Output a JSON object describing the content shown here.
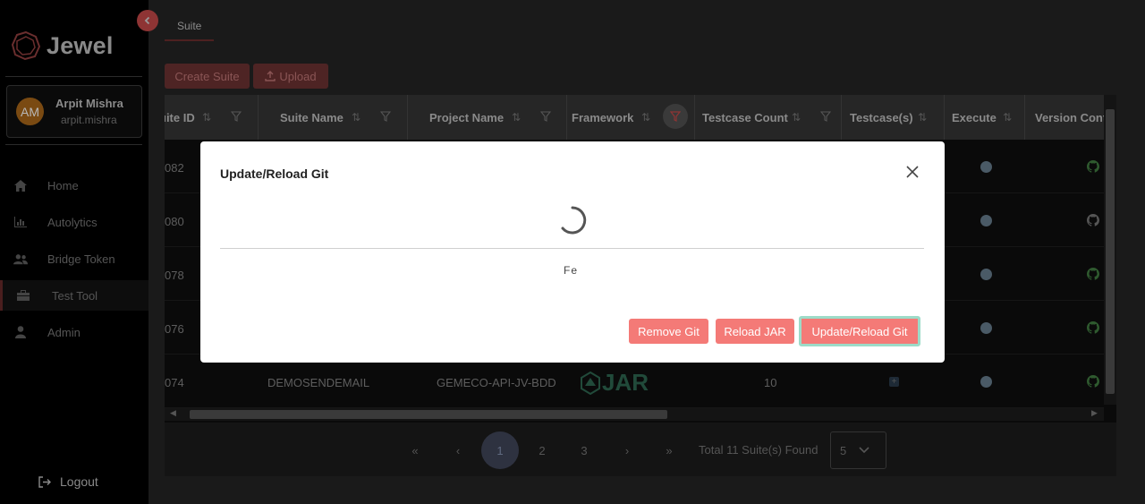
{
  "app": {
    "name": "Jewel"
  },
  "user": {
    "initials": "AM",
    "name": "Arpit Mishra",
    "handle": "arpit.mishra"
  },
  "nav": [
    {
      "label": "Home",
      "icon": "home-icon"
    },
    {
      "label": "Autolytics",
      "icon": "bar-chart-icon"
    },
    {
      "label": "Bridge Token",
      "icon": "users-icon"
    },
    {
      "label": "Test Tool",
      "icon": "toolbox-icon",
      "active": true
    },
    {
      "label": "Admin",
      "icon": "user-icon"
    }
  ],
  "logout_label": "Logout",
  "tabs": [
    {
      "label": "Suite"
    }
  ],
  "toolbar": {
    "create_label": "Create Suite",
    "upload_label": "Upload"
  },
  "table": {
    "columns": [
      "uite ID",
      "Suite Name",
      "Project Name",
      "Framework",
      "Testcase Count",
      "Testcase(s)",
      "Execute",
      "Version Cont"
    ],
    "rows": [
      {
        "id": "082",
        "suite_name": "",
        "project_name": "",
        "framework": "",
        "testcase_count": ""
      },
      {
        "id": "080",
        "suite_name": "",
        "project_name": "",
        "framework": "",
        "testcase_count": ""
      },
      {
        "id": "078",
        "suite_name": "",
        "project_name": "",
        "framework": "",
        "testcase_count": ""
      },
      {
        "id": "076",
        "suite_name": "",
        "project_name": "",
        "framework": "",
        "testcase_count": ""
      },
      {
        "id": "074",
        "suite_name": "DEMOSENDEMAIL",
        "project_name": "GEMECO-API-JV-BDD",
        "framework": "JAR",
        "testcase_count": "10"
      }
    ]
  },
  "pagination": {
    "first": "«",
    "prev": "‹",
    "pages": [
      "1",
      "2",
      "3"
    ],
    "current": "1",
    "next": "›",
    "last": "»",
    "total_text": "Total 11 Suite(s) Found",
    "page_size": "5"
  },
  "modal": {
    "title": "Update/Reload Git",
    "status_text": "Fe",
    "remove_git_label": "Remove Git",
    "reload_jar_label": "Reload JAR",
    "update_reload_label": "Update/Reload Git"
  },
  "colors": {
    "accent": "#f47a77",
    "focus_ring": "#9ddbc8",
    "sidebar": "#1c232a"
  }
}
